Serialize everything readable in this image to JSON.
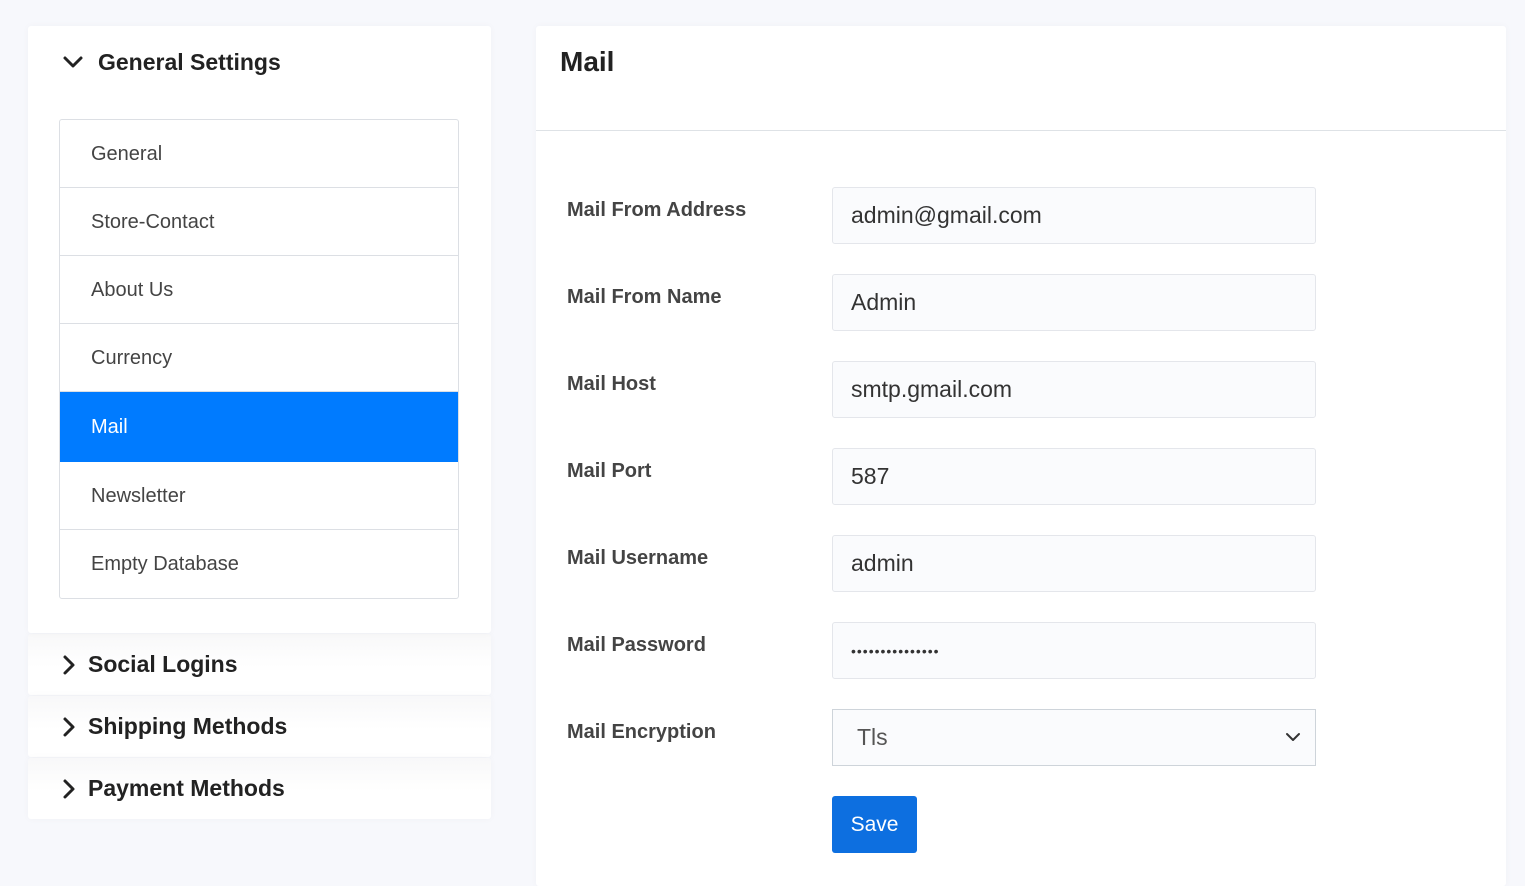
{
  "sidebar": {
    "general_settings": {
      "title": "General Settings",
      "items": [
        {
          "label": "General"
        },
        {
          "label": "Store-Contact"
        },
        {
          "label": "About Us"
        },
        {
          "label": "Currency"
        },
        {
          "label": "Mail",
          "active": true
        },
        {
          "label": "Newsletter"
        },
        {
          "label": "Empty Database"
        }
      ]
    },
    "sections": [
      {
        "title": "Social Logins"
      },
      {
        "title": "Shipping Methods"
      },
      {
        "title": "Payment Methods"
      }
    ]
  },
  "main": {
    "title": "Mail",
    "fields": [
      {
        "label": "Mail From Address",
        "value": "admin@gmail.com"
      },
      {
        "label": "Mail From Name",
        "value": "Admin"
      },
      {
        "label": "Mail Host",
        "value": "smtp.gmail.com"
      },
      {
        "label": "Mail Port",
        "value": "587"
      },
      {
        "label": "Mail Username",
        "value": "admin"
      },
      {
        "label": "Mail Password",
        "value": "•••••••••••••••"
      },
      {
        "label": "Mail Encryption",
        "value": "Tls"
      }
    ],
    "save_label": "Save"
  },
  "colors": {
    "accent": "#007bff",
    "save_button": "#0d6fe0",
    "background": "#f7f8fc"
  }
}
